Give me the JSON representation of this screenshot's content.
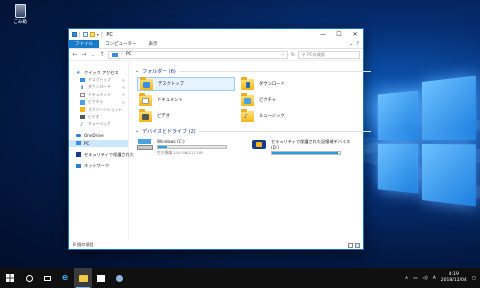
{
  "desktop": {
    "recycle_bin_label": "ごみ箱"
  },
  "window": {
    "title": "PC",
    "controls": {
      "minimize": "—",
      "maximize": "☐",
      "close": "✕"
    },
    "ribbon": {
      "tabs": [
        "ファイル",
        "コンピューター",
        "表示"
      ]
    },
    "address": {
      "path_root": "PC",
      "search_placeholder": "PCの検索"
    },
    "nav": {
      "quick_access": "クイック アクセス",
      "items": [
        "デスクトップ",
        "ダウンロード",
        "ドキュメント",
        "ピクチャ",
        "スクリーンショット",
        "ビデオ",
        "ミュージック"
      ],
      "onedrive": "OneDrive",
      "pc": "PC",
      "secure_drive": "セキュリティで保護された",
      "network": "ネットワーク"
    },
    "content": {
      "folders_header": "フォルダー (6)",
      "folders": [
        "デスクトップ",
        "ダウンロード",
        "ドキュメント",
        "ピクチャ",
        "ビデオ",
        "ミュージック"
      ],
      "drives_header": "デバイスとドライブ (2)",
      "drives": [
        {
          "name": "Windows (C:)",
          "info": "空き領域 110 GB/127 GB",
          "used_fraction": 0.13
        },
        {
          "name": "セキュリティで保護された記憶域デバイス",
          "letter": "(D:)",
          "used_fraction": 0.97
        }
      ]
    },
    "status": "8 個の項目"
  },
  "taskbar": {
    "ime": "A",
    "time": "4:19",
    "date": "2018/12/04"
  }
}
